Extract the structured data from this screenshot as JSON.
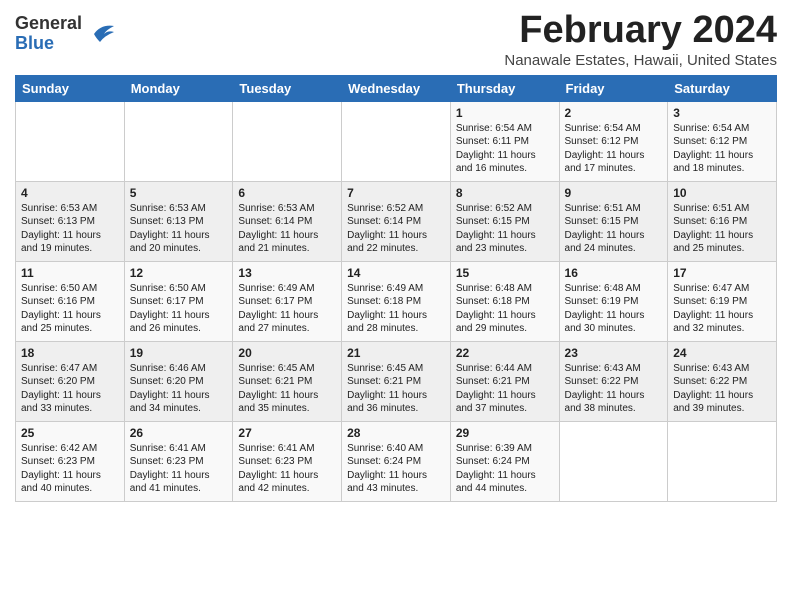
{
  "logo": {
    "general": "General",
    "blue": "Blue"
  },
  "title": "February 2024",
  "subtitle": "Nanawale Estates, Hawaii, United States",
  "days_of_week": [
    "Sunday",
    "Monday",
    "Tuesday",
    "Wednesday",
    "Thursday",
    "Friday",
    "Saturday"
  ],
  "weeks": [
    [
      {
        "day": "",
        "info": ""
      },
      {
        "day": "",
        "info": ""
      },
      {
        "day": "",
        "info": ""
      },
      {
        "day": "",
        "info": ""
      },
      {
        "day": "1",
        "info": "Sunrise: 6:54 AM\nSunset: 6:11 PM\nDaylight: 11 hours and 16 minutes."
      },
      {
        "day": "2",
        "info": "Sunrise: 6:54 AM\nSunset: 6:12 PM\nDaylight: 11 hours and 17 minutes."
      },
      {
        "day": "3",
        "info": "Sunrise: 6:54 AM\nSunset: 6:12 PM\nDaylight: 11 hours and 18 minutes."
      }
    ],
    [
      {
        "day": "4",
        "info": "Sunrise: 6:53 AM\nSunset: 6:13 PM\nDaylight: 11 hours and 19 minutes."
      },
      {
        "day": "5",
        "info": "Sunrise: 6:53 AM\nSunset: 6:13 PM\nDaylight: 11 hours and 20 minutes."
      },
      {
        "day": "6",
        "info": "Sunrise: 6:53 AM\nSunset: 6:14 PM\nDaylight: 11 hours and 21 minutes."
      },
      {
        "day": "7",
        "info": "Sunrise: 6:52 AM\nSunset: 6:14 PM\nDaylight: 11 hours and 22 minutes."
      },
      {
        "day": "8",
        "info": "Sunrise: 6:52 AM\nSunset: 6:15 PM\nDaylight: 11 hours and 23 minutes."
      },
      {
        "day": "9",
        "info": "Sunrise: 6:51 AM\nSunset: 6:15 PM\nDaylight: 11 hours and 24 minutes."
      },
      {
        "day": "10",
        "info": "Sunrise: 6:51 AM\nSunset: 6:16 PM\nDaylight: 11 hours and 25 minutes."
      }
    ],
    [
      {
        "day": "11",
        "info": "Sunrise: 6:50 AM\nSunset: 6:16 PM\nDaylight: 11 hours and 25 minutes."
      },
      {
        "day": "12",
        "info": "Sunrise: 6:50 AM\nSunset: 6:17 PM\nDaylight: 11 hours and 26 minutes."
      },
      {
        "day": "13",
        "info": "Sunrise: 6:49 AM\nSunset: 6:17 PM\nDaylight: 11 hours and 27 minutes."
      },
      {
        "day": "14",
        "info": "Sunrise: 6:49 AM\nSunset: 6:18 PM\nDaylight: 11 hours and 28 minutes."
      },
      {
        "day": "15",
        "info": "Sunrise: 6:48 AM\nSunset: 6:18 PM\nDaylight: 11 hours and 29 minutes."
      },
      {
        "day": "16",
        "info": "Sunrise: 6:48 AM\nSunset: 6:19 PM\nDaylight: 11 hours and 30 minutes."
      },
      {
        "day": "17",
        "info": "Sunrise: 6:47 AM\nSunset: 6:19 PM\nDaylight: 11 hours and 32 minutes."
      }
    ],
    [
      {
        "day": "18",
        "info": "Sunrise: 6:47 AM\nSunset: 6:20 PM\nDaylight: 11 hours and 33 minutes."
      },
      {
        "day": "19",
        "info": "Sunrise: 6:46 AM\nSunset: 6:20 PM\nDaylight: 11 hours and 34 minutes."
      },
      {
        "day": "20",
        "info": "Sunrise: 6:45 AM\nSunset: 6:21 PM\nDaylight: 11 hours and 35 minutes."
      },
      {
        "day": "21",
        "info": "Sunrise: 6:45 AM\nSunset: 6:21 PM\nDaylight: 11 hours and 36 minutes."
      },
      {
        "day": "22",
        "info": "Sunrise: 6:44 AM\nSunset: 6:21 PM\nDaylight: 11 hours and 37 minutes."
      },
      {
        "day": "23",
        "info": "Sunrise: 6:43 AM\nSunset: 6:22 PM\nDaylight: 11 hours and 38 minutes."
      },
      {
        "day": "24",
        "info": "Sunrise: 6:43 AM\nSunset: 6:22 PM\nDaylight: 11 hours and 39 minutes."
      }
    ],
    [
      {
        "day": "25",
        "info": "Sunrise: 6:42 AM\nSunset: 6:23 PM\nDaylight: 11 hours and 40 minutes."
      },
      {
        "day": "26",
        "info": "Sunrise: 6:41 AM\nSunset: 6:23 PM\nDaylight: 11 hours and 41 minutes."
      },
      {
        "day": "27",
        "info": "Sunrise: 6:41 AM\nSunset: 6:23 PM\nDaylight: 11 hours and 42 minutes."
      },
      {
        "day": "28",
        "info": "Sunrise: 6:40 AM\nSunset: 6:24 PM\nDaylight: 11 hours and 43 minutes."
      },
      {
        "day": "29",
        "info": "Sunrise: 6:39 AM\nSunset: 6:24 PM\nDaylight: 11 hours and 44 minutes."
      },
      {
        "day": "",
        "info": ""
      },
      {
        "day": "",
        "info": ""
      }
    ]
  ]
}
